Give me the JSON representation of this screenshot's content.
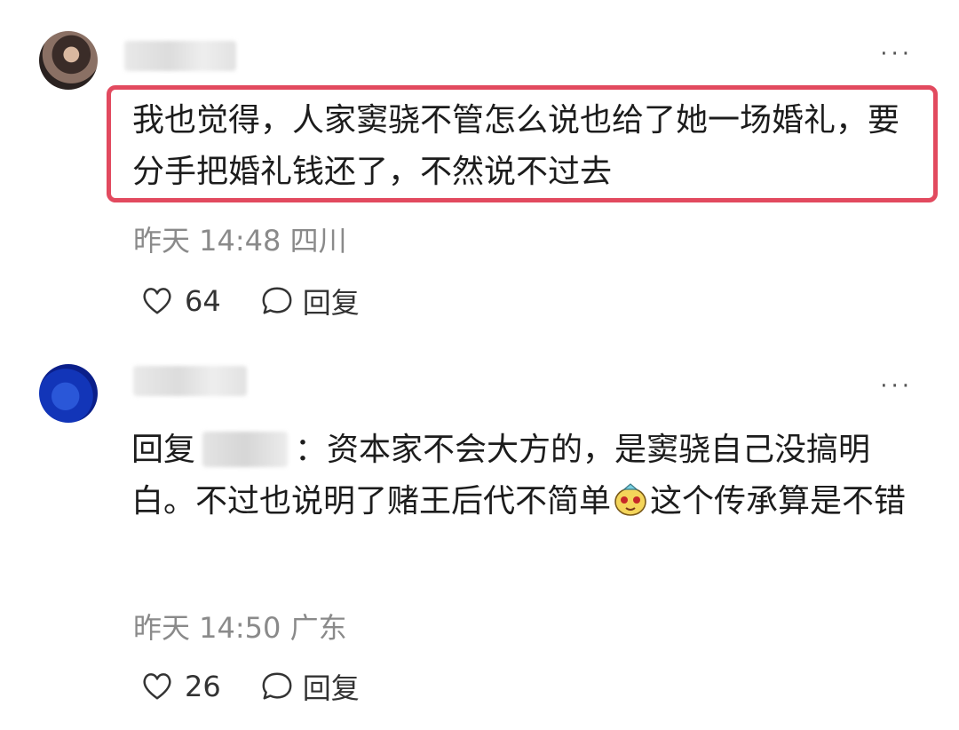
{
  "comments": [
    {
      "text": "我也觉得，人家窦骁不管怎么说也给了她一场婚礼，要分手把婚礼钱还了，不然说不过去",
      "time": "昨天 14:48",
      "location": "四川",
      "likes": "64",
      "reply_label": "回复",
      "more_label": "···"
    },
    {
      "reply_prefix": "回复",
      "text_a": "：资本家不会大方的，是窦骁自己没搞明白。不过也说明了赌王后代不简单",
      "text_b": "这个传承算是不错",
      "time": "昨天 14:50",
      "location": "广东",
      "likes": "26",
      "reply_label": "回复",
      "more_label": "···"
    }
  ],
  "icons": {
    "like": "heart-outline-icon",
    "reply": "speech-bubble-icon",
    "more": "more-dots-icon",
    "emoji": "yellow-face-emoji-icon"
  },
  "colors": {
    "highlight_border": "#e24a5f",
    "meta_text": "#8a8a8a"
  }
}
